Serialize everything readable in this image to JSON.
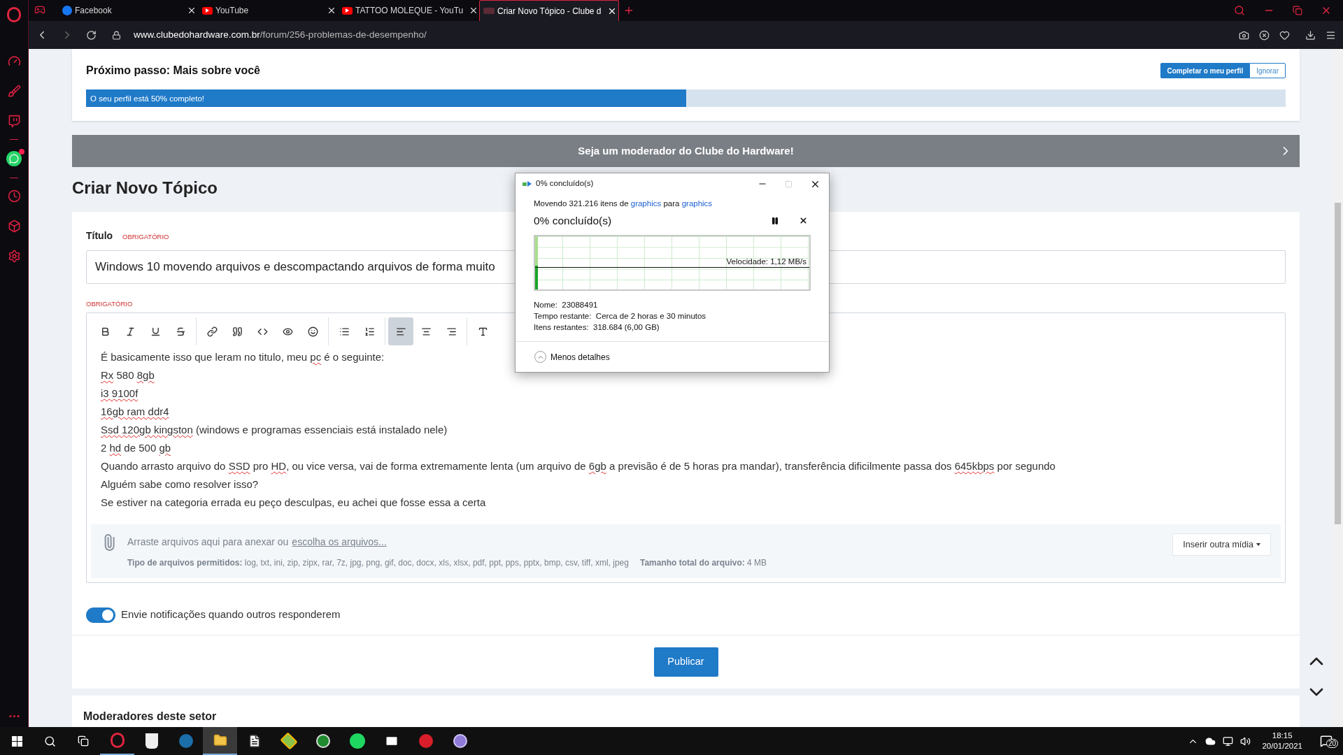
{
  "browser": {
    "tabs": [
      {
        "label": "Facebook",
        "selected": false,
        "kind": "facebook"
      },
      {
        "label": "YouTube",
        "selected": false,
        "kind": "youtube"
      },
      {
        "label": "TATTOO MOLEQUE - YouTu",
        "selected": false,
        "kind": "youtube"
      },
      {
        "label": "Criar Novo Tópico - Clube d",
        "selected": true,
        "kind": "site"
      }
    ],
    "url_host": "www.clubedohardware.com.br",
    "url_path": "/forum/256-problemas-de-desempenho/"
  },
  "profile": {
    "title": "Próximo passo: Mais sobre você",
    "complete_button": "Completar o meu perfil",
    "ignore_button": "Ignorar",
    "progress_label": "O seu perfil está 50% completo!",
    "level": 0.5
  },
  "banner": "Seja um moderador do Clube do Hardware!",
  "heading": "Criar Novo Tópico",
  "form": {
    "title_label": "Título",
    "title_required": "OBRIGATÓRIO",
    "title_value": "Windows 10 movendo arquivos e descompactando arquivos de forma muito",
    "body_required": "OBRIGATÓRIO",
    "toolbar": [
      {
        "selected": false
      },
      {
        "selected": false
      },
      {
        "selected": false
      },
      {
        "selected": false
      },
      {
        "selected": false
      },
      {
        "selected": false
      },
      {
        "selected": false
      },
      {
        "selected": false
      },
      {
        "selected": false
      },
      {
        "selected": false
      },
      {
        "selected": false
      },
      {
        "selected": true
      },
      {
        "selected": false
      },
      {
        "selected": false
      },
      {
        "selected": false
      }
    ],
    "lines": [
      {
        "segments": [
          {
            "text": "É basicamente isso que leram no titulo, meu ",
            "misspelled": false
          },
          {
            "text": "pc",
            "misspelled": true
          },
          {
            "text": " é o seguinte:",
            "misspelled": false
          }
        ]
      },
      {
        "segments": [
          {
            "text": "Rx",
            "misspelled": true
          },
          {
            "text": " 580 ",
            "misspelled": false
          },
          {
            "text": "8gb",
            "misspelled": true
          }
        ]
      },
      {
        "segments": [
          {
            "text": "i3 9100f",
            "misspelled": true
          }
        ]
      },
      {
        "segments": [
          {
            "text": "16gb ram ddr4",
            "misspelled": true
          }
        ]
      },
      {
        "segments": [
          {
            "text": "Ssd 120gb kingston",
            "misspelled": true
          },
          {
            "text": " (windows e programas essenciais está instalado nele)",
            "misspelled": false
          }
        ]
      },
      {
        "segments": [
          {
            "text": "2 ",
            "misspelled": false
          },
          {
            "text": "hd",
            "misspelled": true
          },
          {
            "text": " de 500 ",
            "misspelled": false
          },
          {
            "text": "gb",
            "misspelled": true
          }
        ]
      },
      {
        "segments": [
          {
            "text": "Quando arrasto arquivo do ",
            "misspelled": false
          },
          {
            "text": "SSD",
            "misspelled": true
          },
          {
            "text": " pro ",
            "misspelled": false
          },
          {
            "text": "HD",
            "misspelled": true
          },
          {
            "text": ", ou vice versa, vai de forma extremamente lenta (um arquivo de ",
            "misspelled": false
          },
          {
            "text": "6gb",
            "misspelled": true
          },
          {
            "text": " a previsão é de 5 horas pra mandar), transferência dificilmente passa dos ",
            "misspelled": false
          },
          {
            "text": "645kbps",
            "misspelled": true
          },
          {
            "text": " por segundo",
            "misspelled": false
          }
        ]
      },
      {
        "segments": [
          {
            "text": "Alguém sabe como resolver isso?",
            "misspelled": false
          }
        ]
      },
      {
        "segments": [
          {
            "text": "Se estiver na categoria errada eu peço desculpas, eu achei que fosse essa a certa",
            "misspelled": false
          }
        ]
      }
    ],
    "attach_text": "Arraste arquivos aqui para anexar ou",
    "attach_link": "escolha os arquivos...",
    "allowed_label": "Tipo de arquivos permitidos:",
    "allowed_value": "log, txt, ini, zip, zipx, rar, 7z, jpg, png, gif, doc, docx, xls, xlsx, pdf, ppt, pps, pptx, bmp, csv, tiff, xml, jpeg",
    "size_label": "Tamanho total do arquivo:",
    "size_value": "4 MB",
    "media_button": "Inserir outra mídia",
    "notify": {
      "label": "Envie notificações quando outros responderem",
      "on": true
    },
    "publish": "Publicar"
  },
  "moderators_title": "Moderadores deste setor",
  "dialog": {
    "title": "0% concluído(s)",
    "moving_prefix": "Movendo 321.216 itens de",
    "source": "graphics",
    "moving_mid": "para",
    "dest": "graphics",
    "status": "0% concluído(s)",
    "speed": "Velocidade: 1,12 MB/s",
    "level": 0.01,
    "details": [
      {
        "label": "Nome:",
        "value": "23088491"
      },
      {
        "label": "Tempo restante:",
        "value": "Cerca de 2 horas e 30 minutos"
      },
      {
        "label": "Itens restantes:",
        "value": "318.684 (6,00 GB)"
      }
    ],
    "less_details": "Menos detalhes"
  },
  "taskbar": {
    "time": "18:15",
    "date": "20/01/2021",
    "notifications": "20"
  }
}
